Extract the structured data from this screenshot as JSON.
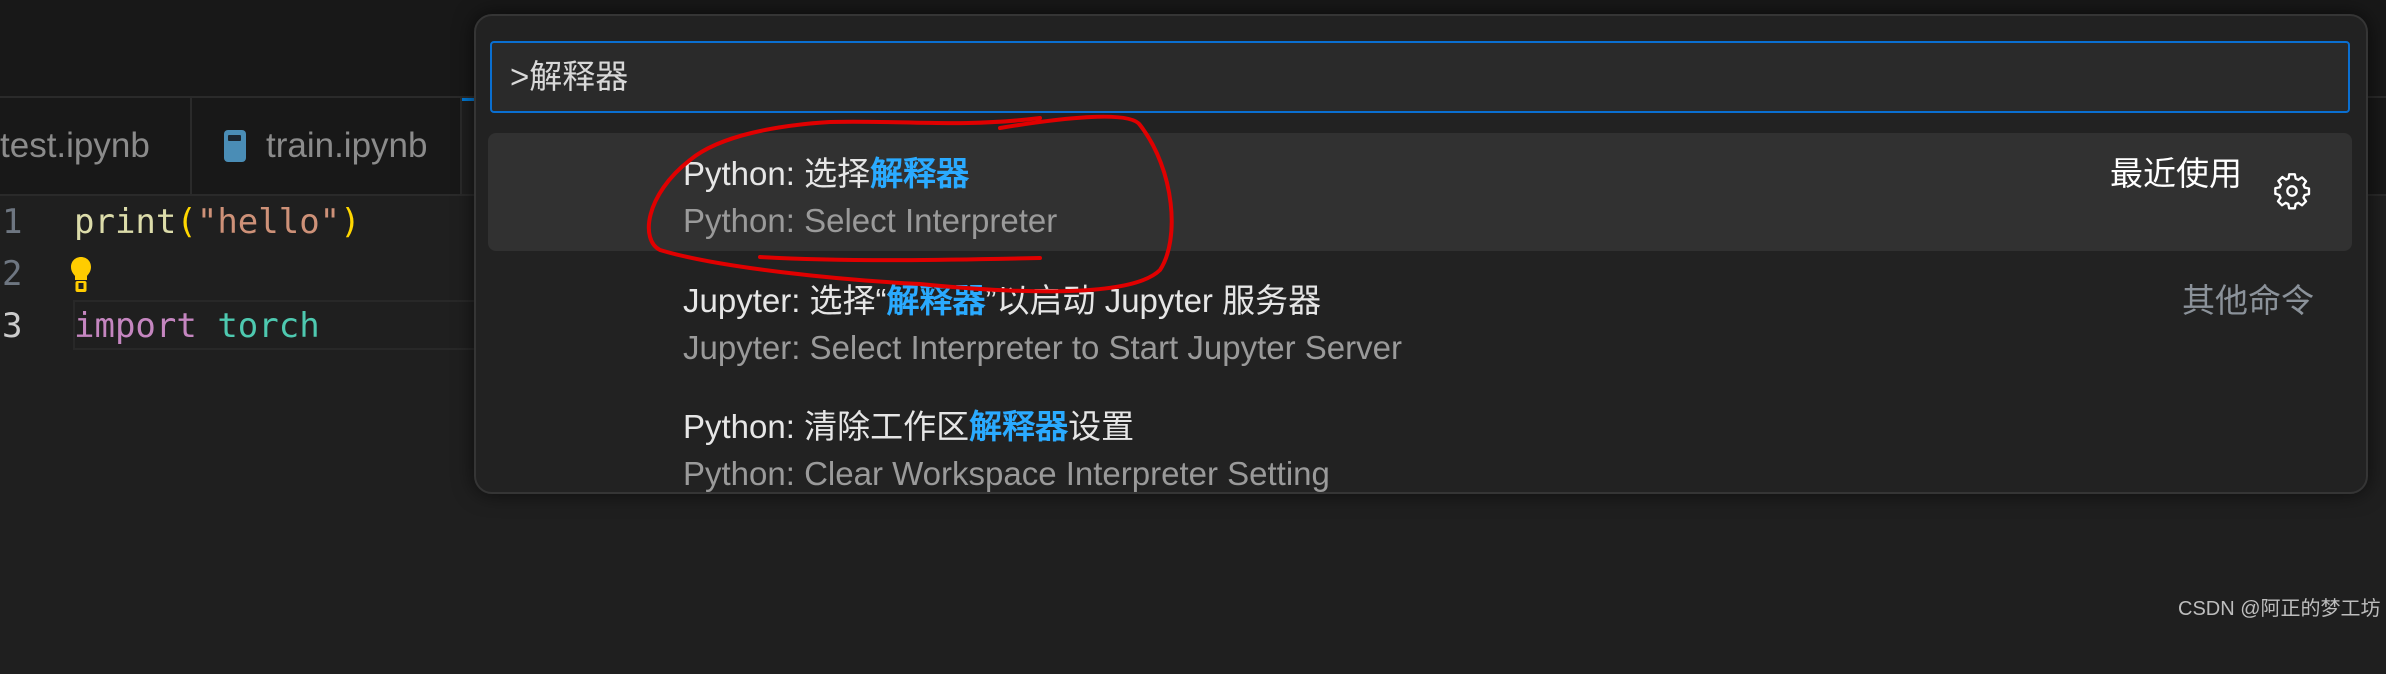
{
  "tabs": [
    {
      "label": "test.ipynb"
    },
    {
      "label": "train.ipynb",
      "icon": "notebook-icon"
    }
  ],
  "editor": {
    "lines": [
      {
        "number": "1",
        "tokens": [
          {
            "text": "print",
            "color": "#dcdcaa"
          },
          {
            "text": "(",
            "color": "#ffd700"
          },
          {
            "text": "\"hello\"",
            "color": "#ce9178"
          },
          {
            "text": ")",
            "color": "#ffd700"
          }
        ]
      },
      {
        "number": "2",
        "lightbulb": true
      },
      {
        "number": "3",
        "tokens": [
          {
            "text": "import",
            "color": "#c586c0"
          },
          {
            "text": " ",
            "color": "#ccc"
          },
          {
            "text": "torch",
            "color": "#4ec9b0"
          }
        ]
      }
    ]
  },
  "command_palette": {
    "input_value": ">解释器",
    "items": [
      {
        "label_prefix": "Python: 选择",
        "label_match": "解释器",
        "label_suffix": "",
        "description": "Python: Select Interpreter",
        "tag": "最近使用",
        "selected": true
      },
      {
        "label_prefix": "Jupyter: 选择“",
        "label_match": "解释器",
        "label_suffix": "”以启动 Jupyter 服务器",
        "description": "Jupyter: Select Interpreter to Start Jupyter Server",
        "tag": "其他命令",
        "selected": false
      },
      {
        "label_prefix": "Python: 清除工作区",
        "label_match": "解释器",
        "label_suffix": "设置",
        "description": "Python: Clear Workspace Interpreter Setting",
        "tag": "",
        "selected": false
      }
    ],
    "colors": {
      "accent": "#0a6fd1",
      "match": "#2aaaff",
      "annotation": "#e00000"
    }
  },
  "watermark": "CSDN @阿正的梦工坊"
}
